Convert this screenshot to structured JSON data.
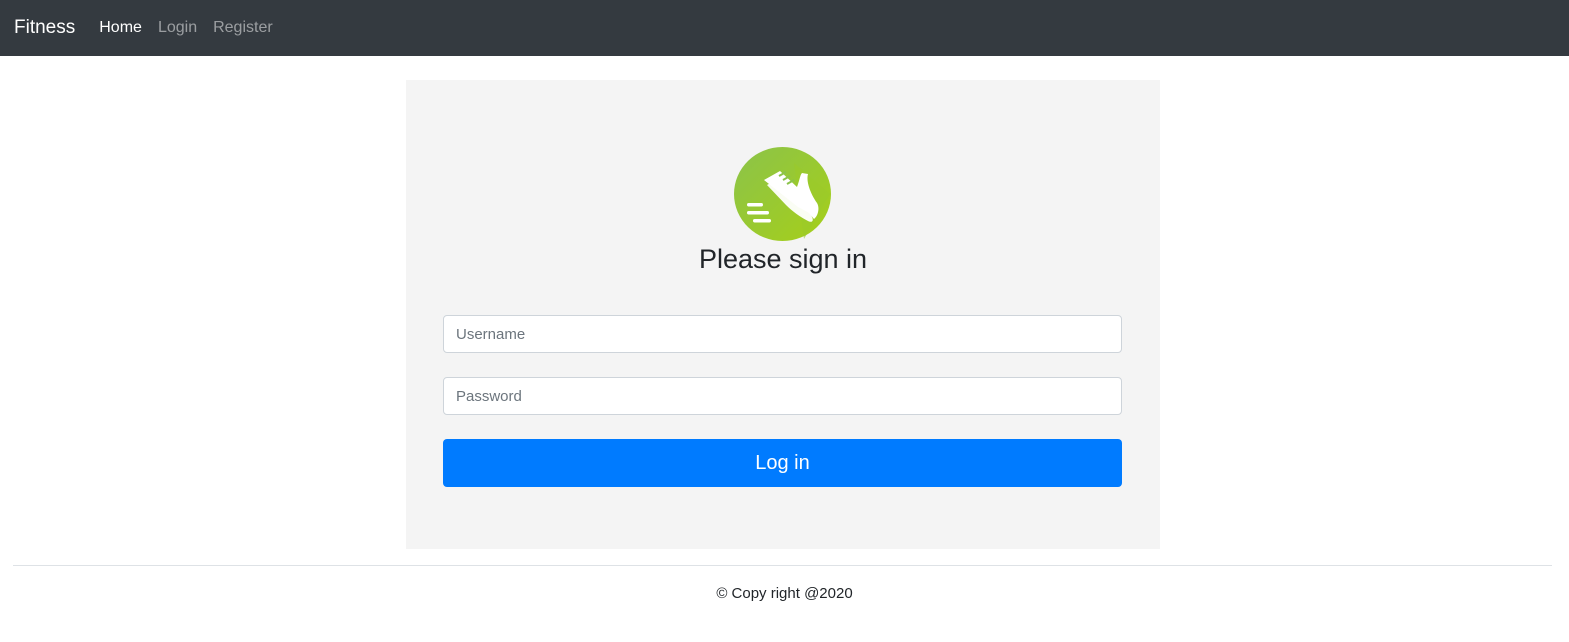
{
  "navbar": {
    "brand": "Fitness",
    "links": [
      {
        "label": "Home",
        "active": true
      },
      {
        "label": "Login",
        "active": false
      },
      {
        "label": "Register",
        "active": false
      }
    ]
  },
  "login": {
    "logo_icon": "running-shoe-icon",
    "heading": "Please sign in",
    "username": {
      "placeholder": "Username",
      "value": ""
    },
    "password": {
      "placeholder": "Password",
      "value": ""
    },
    "submit_label": "Log in"
  },
  "footer": {
    "text": "© Copy right @2020"
  },
  "colors": {
    "navbar_bg": "#343a40",
    "card_bg": "#f4f4f4",
    "primary": "#007bff",
    "logo_green": "#8cc63f"
  }
}
